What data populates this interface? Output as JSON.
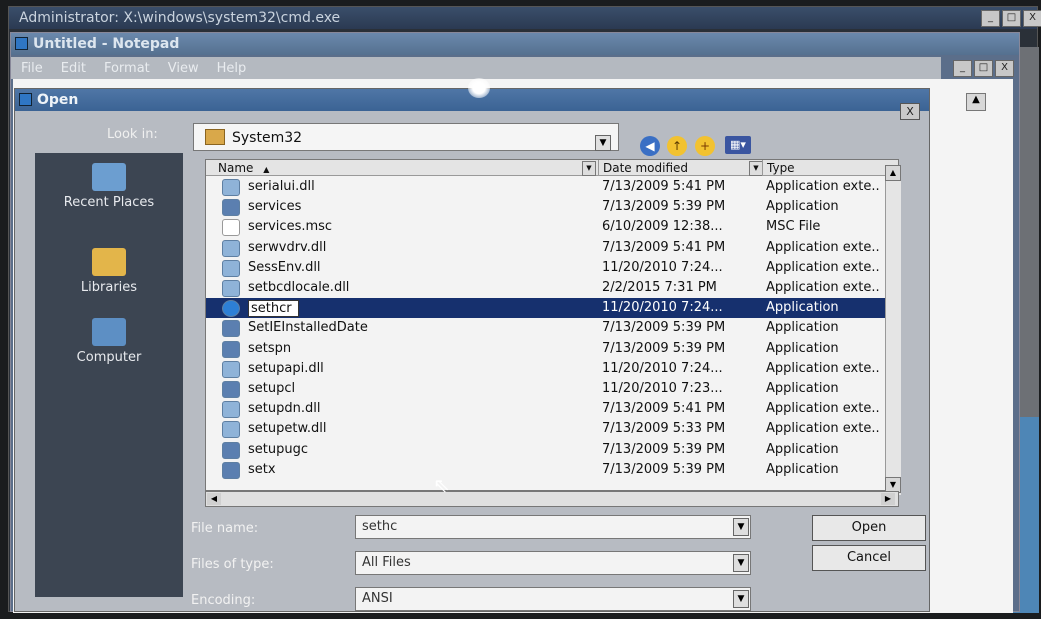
{
  "cmd": {
    "title": "Administrator: X:\\windows\\system32\\cmd.exe",
    "sys_buttons": [
      "_",
      "□",
      "X"
    ]
  },
  "notepad": {
    "title": "Untitled - Notepad",
    "menu": [
      "File",
      "Edit",
      "Format",
      "View",
      "Help"
    ],
    "sys_buttons": [
      "_",
      "□",
      "X"
    ],
    "scroll_up": "▲"
  },
  "dialog": {
    "title": "Open",
    "close": "X",
    "look_in_label": "Look in:",
    "look_in_value": "System32",
    "dropdown_arrow": "▼",
    "toolbar": {
      "back": "◀",
      "up": "↑",
      "new_folder": "+",
      "views": "▦▾"
    },
    "places": [
      {
        "label": "Recent Places",
        "icon": "recent-places-icon",
        "color": "#6c9ed0"
      },
      {
        "label": "Libraries",
        "icon": "libraries-icon",
        "color": "#e3b54a"
      },
      {
        "label": "Computer",
        "icon": "computer-icon",
        "color": "#5d8fc4"
      }
    ],
    "columns": {
      "name": "Name",
      "name_sort": "▲",
      "date": "Date modified",
      "type": "Type",
      "drop": "▼"
    },
    "files": [
      {
        "name": "serialui.dll",
        "date": "7/13/2009 5:41 PM",
        "type": "Application exte..",
        "icon": "dll-icon"
      },
      {
        "name": "services",
        "date": "7/13/2009 5:39 PM",
        "type": "Application",
        "icon": "application-icon"
      },
      {
        "name": "services.msc",
        "date": "6/10/2009 12:38...",
        "type": "MSC File",
        "icon": "msc-file-icon"
      },
      {
        "name": "serwvdrv.dll",
        "date": "7/13/2009 5:41 PM",
        "type": "Application exte..",
        "icon": "dll-icon"
      },
      {
        "name": "SessEnv.dll",
        "date": "11/20/2010 7:24...",
        "type": "Application exte..",
        "icon": "dll-icon"
      },
      {
        "name": "setbcdlocale.dll",
        "date": "2/2/2015 7:31 PM",
        "type": "Application exte..",
        "icon": "dll-icon"
      },
      {
        "name": "sethcr",
        "date": "11/20/2010 7:24...",
        "type": "Application",
        "icon": "application-icon",
        "selected": true
      },
      {
        "name": "SetIEInstalledDate",
        "date": "7/13/2009 5:39 PM",
        "type": "Application",
        "icon": "application-icon"
      },
      {
        "name": "setspn",
        "date": "7/13/2009 5:39 PM",
        "type": "Application",
        "icon": "application-icon"
      },
      {
        "name": "setupapi.dll",
        "date": "11/20/2010 7:24...",
        "type": "Application exte..",
        "icon": "dll-icon"
      },
      {
        "name": "setupcl",
        "date": "11/20/2010 7:23...",
        "type": "Application",
        "icon": "application-icon"
      },
      {
        "name": "setupdn.dll",
        "date": "7/13/2009 5:41 PM",
        "type": "Application exte..",
        "icon": "dll-icon"
      },
      {
        "name": "setupetw.dll",
        "date": "7/13/2009 5:33 PM",
        "type": "Application exte..",
        "icon": "dll-icon"
      },
      {
        "name": "setupugc",
        "date": "7/13/2009 5:39 PM",
        "type": "Application",
        "icon": "application-icon"
      },
      {
        "name": "setx",
        "date": "7/13/2009 5:39 PM",
        "type": "Application",
        "icon": "application-icon"
      }
    ],
    "scroll": {
      "up": "▲",
      "down": "▼",
      "left": "◀",
      "right": "▶"
    },
    "file_name_label": "File name:",
    "file_name_value": "sethc",
    "files_of_type_label": "Files of type:",
    "files_of_type_value": "All Files",
    "encoding_label": "Encoding:",
    "encoding_value": "ANSI",
    "open_label": "Open",
    "cancel_label": "Cancel",
    "cursor": "⇖"
  }
}
